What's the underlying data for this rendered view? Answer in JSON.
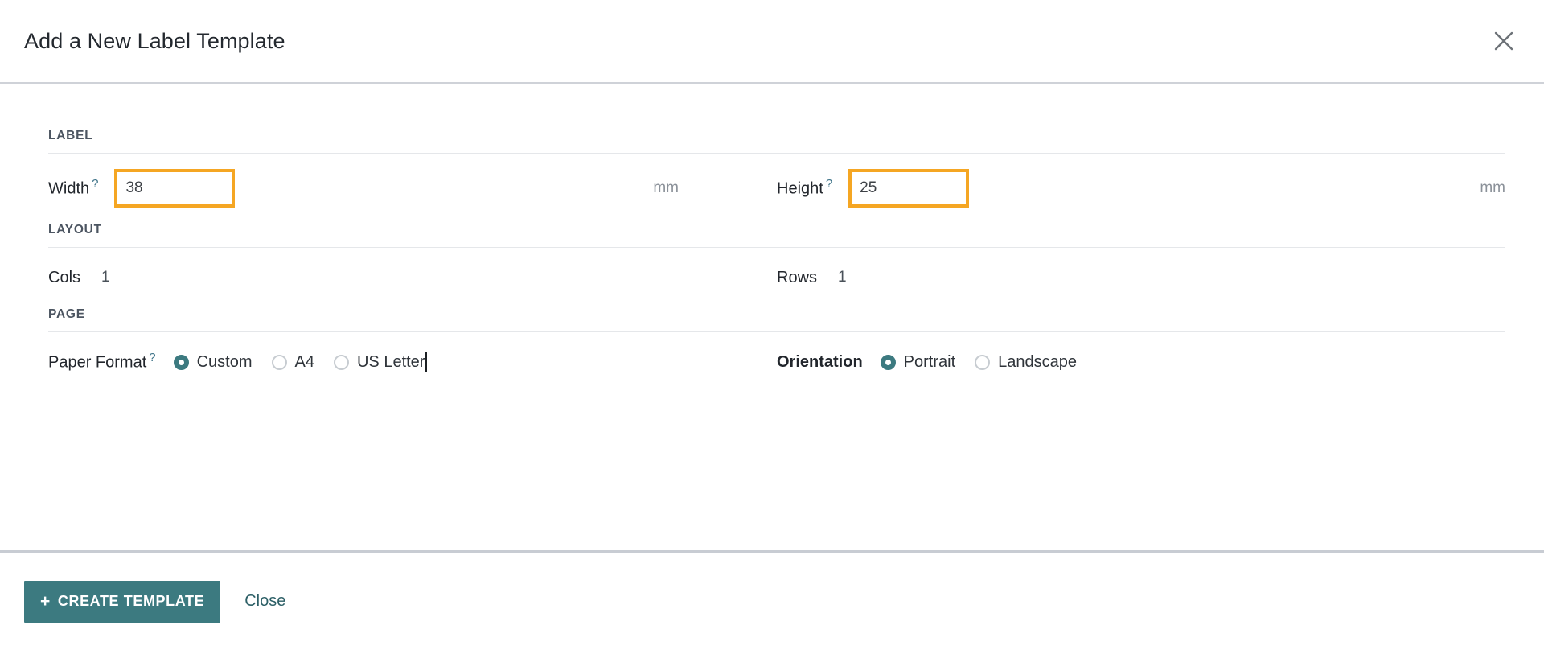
{
  "dialog": {
    "title": "Add a New Label Template",
    "close_icon": "close-icon"
  },
  "sections": {
    "label": {
      "heading": "LABEL",
      "width": {
        "label": "Width",
        "help": "?",
        "value": "38",
        "unit": "mm"
      },
      "height": {
        "label": "Height",
        "help": "?",
        "value": "25",
        "unit": "mm"
      }
    },
    "layout": {
      "heading": "LAYOUT",
      "cols": {
        "label": "Cols",
        "value": "1"
      },
      "rows": {
        "label": "Rows",
        "value": "1"
      }
    },
    "page": {
      "heading": "PAGE",
      "paper_format": {
        "label": "Paper Format",
        "help": "?",
        "options": [
          {
            "label": "Custom",
            "checked": true
          },
          {
            "label": "A4",
            "checked": false
          },
          {
            "label": "US Letter",
            "checked": false
          }
        ],
        "selected": "Custom"
      },
      "orientation": {
        "label": "Orientation",
        "options": [
          {
            "label": "Portrait",
            "checked": true
          },
          {
            "label": "Landscape",
            "checked": false
          }
        ],
        "selected": "Portrait"
      }
    }
  },
  "footer": {
    "create_plus": "+",
    "create_label": "CREATE TEMPLATE",
    "close_label": "Close"
  },
  "colors": {
    "accent_teal": "#3c7a80",
    "focus_orange": "#f5a623",
    "help_blue": "#3f7489",
    "divider": "#e5e7ea",
    "heavy_divider": "#c8ccd3"
  }
}
